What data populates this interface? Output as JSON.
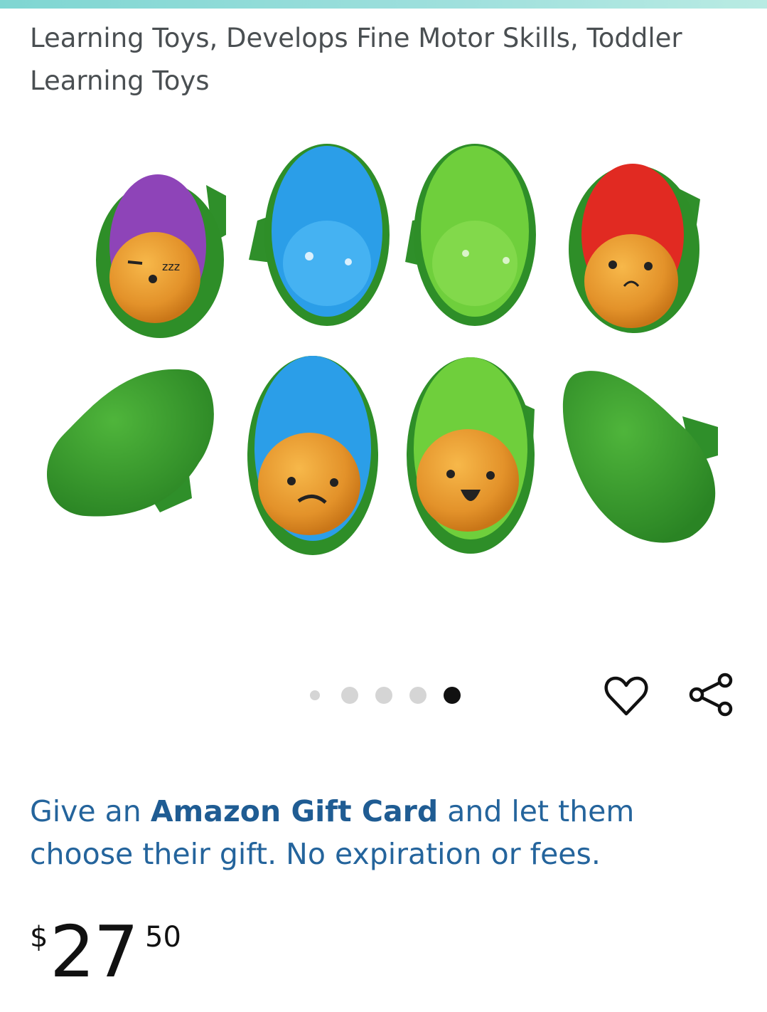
{
  "product": {
    "title_line1": "Learning Toys, Develops Fine Motor Skills, Toddler",
    "title_line2": "Learning Toys"
  },
  "gallery": {
    "image_name": "avocado-toy-set",
    "total_images": 5,
    "active_index": 4
  },
  "actions": {
    "wishlist_icon": "heart-icon",
    "share_icon": "share-icon"
  },
  "promo": {
    "prefix": "Give an ",
    "highlight": "Amazon Gift Card",
    "suffix": " and let them choose their gift. No expiration or fees."
  },
  "price": {
    "symbol": "$",
    "whole": "27",
    "fraction": "50"
  },
  "colors": {
    "link_blue": "#24649c",
    "avocado_green": "#3b9a2e",
    "pit_orange": "#e3952a"
  }
}
